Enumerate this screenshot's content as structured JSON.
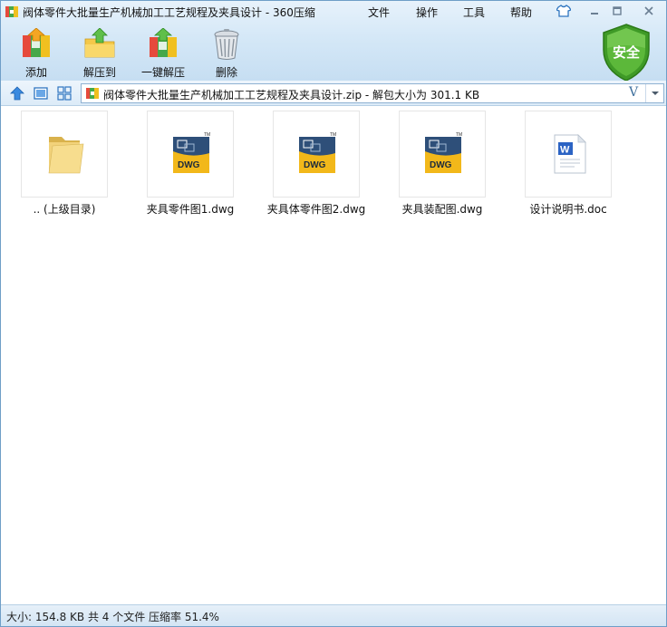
{
  "window": {
    "title": "阀体零件大批量生产机械加工工艺规程及夹具设计 - 360压缩"
  },
  "menu": [
    {
      "label": "文件"
    },
    {
      "label": "操作"
    },
    {
      "label": "工具"
    },
    {
      "label": "帮助"
    }
  ],
  "toolbar": [
    {
      "label": "添加",
      "icon": "add-archive-icon"
    },
    {
      "label": "解压到",
      "icon": "extract-to-icon"
    },
    {
      "label": "一键解压",
      "icon": "one-click-extract-icon"
    },
    {
      "label": "删除",
      "icon": "trash-icon"
    }
  ],
  "security": {
    "label": "安全",
    "color": "#4aa32a"
  },
  "address": {
    "path": "阀体零件大批量生产机械加工工艺规程及夹具设计.zip - 解包大小为 301.1 KB",
    "v_label": "V"
  },
  "files": [
    {
      "name": ".. (上级目录)",
      "icon": "folder-icon"
    },
    {
      "name": "夹具零件图1.dwg",
      "icon": "dwg-file-icon"
    },
    {
      "name": "夹具体零件图2.dwg",
      "icon": "dwg-file-icon"
    },
    {
      "name": "夹具装配图.dwg",
      "icon": "dwg-file-icon"
    },
    {
      "name": "设计说明书.doc",
      "icon": "doc-file-icon"
    }
  ],
  "status": {
    "text": "大小: 154.8 KB 共 4 个文件 压缩率 51.4%"
  },
  "colors": {
    "accent": "#3c6e9c",
    "dwg_yellow": "#f2b81a",
    "word_blue": "#2b63c4"
  }
}
